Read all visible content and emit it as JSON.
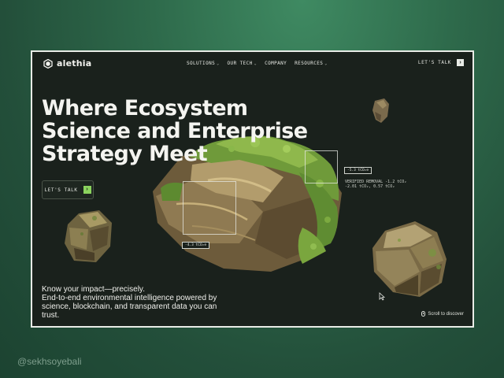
{
  "brand": {
    "name": "alethia"
  },
  "nav": {
    "items": [
      {
        "label": "SOLUTIONS",
        "has_dropdown": true
      },
      {
        "label": "OUR TECH",
        "has_dropdown": true
      },
      {
        "label": "COMPANY",
        "has_dropdown": false
      },
      {
        "label": "RESOURCES",
        "has_dropdown": true
      }
    ],
    "cta_label": "LET'S TALK",
    "cta_icon": "arrow-right-icon"
  },
  "hero": {
    "headline_lines": [
      "Where Ecosystem",
      "Science and Enterprise",
      "Strategy Meet"
    ],
    "cta_label": "LET'S TALK",
    "tag_top": "-5.3 tCO₂e",
    "tag_left": "-4.3 tCO₂e",
    "verified_line1": "VERIFIED REMOVAL -1.2  tCO₂",
    "verified_line2": "-2.01 tCO₂, 0.57 tCO₂",
    "impact_title": "Know your impact—precisely.",
    "impact_body": "End-to-end environmental intelligence powered by science, blockchain, and transparent data you can trust."
  },
  "scroll_label": "Scroll to discover",
  "watermark": "@sekhsoyebali",
  "colors": {
    "frame_bg": "#1a211c",
    "accent_green": "#8bd35e",
    "text_light": "#f4f4f0",
    "outer_bg": "#2e6a4b"
  }
}
